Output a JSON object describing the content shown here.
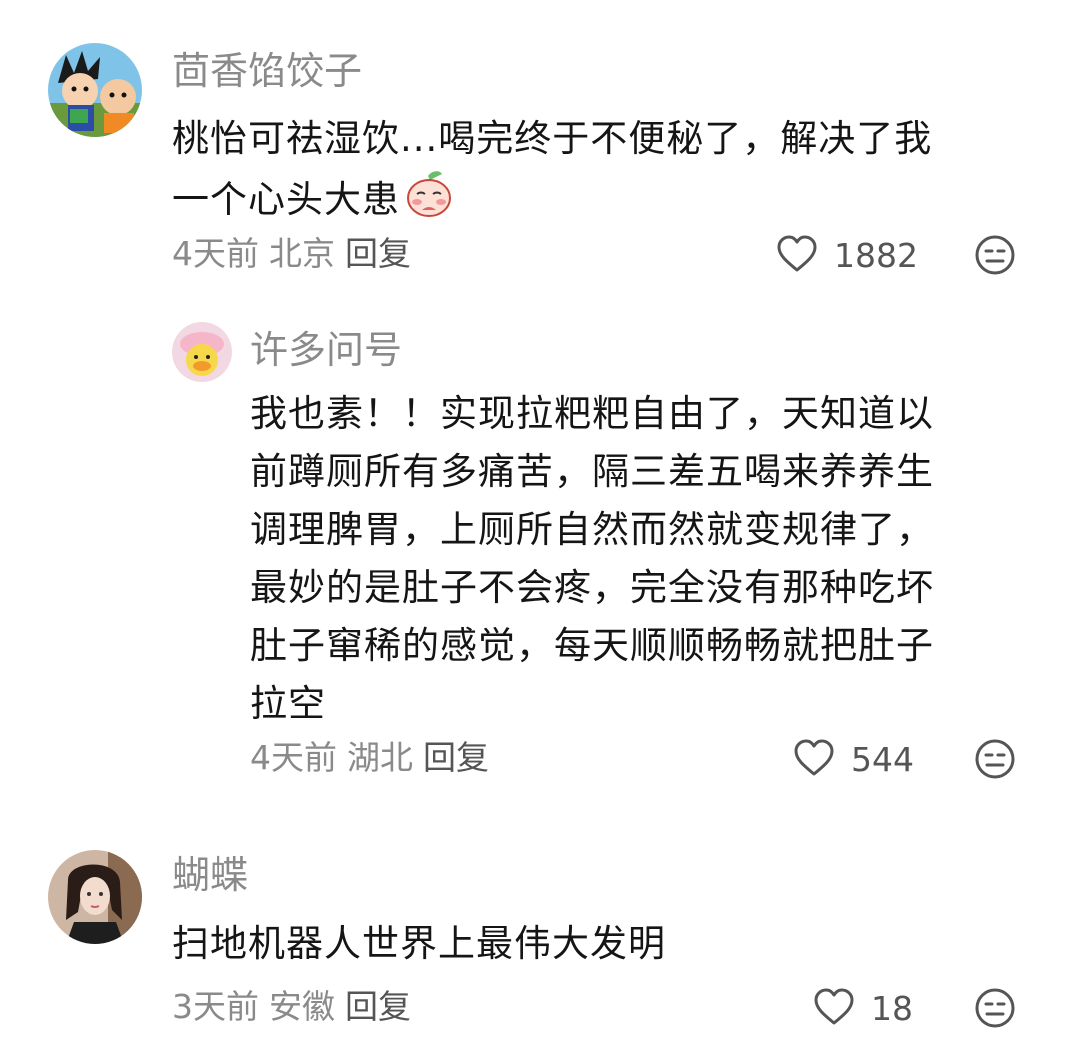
{
  "comments": [
    {
      "username": "茴香馅饺子",
      "lines": [
        "桃怡可祛湿饮...喝完终于不便秘了，解决了我",
        "一个心头大患"
      ],
      "emoji": "peach-face-emoji",
      "time": "4天前",
      "location": "北京",
      "reply_label": "回复",
      "likes": "1882",
      "avatar": "cartoon-two-kids-avatar"
    },
    {
      "username": "许多问号",
      "lines": [
        "我也素！！实现拉粑粑自由了，天知道以",
        "前蹲厕所有多痛苦，隔三差五喝来养养生",
        "调理脾胃，上厕所自然而然就变规律了，",
        "最妙的是肚子不会疼，完全没有那种吃坏",
        "肚子窜稀的感觉，每天顺顺畅畅就把肚子",
        "拉空"
      ],
      "time": "4天前",
      "location": "湖北",
      "reply_label": "回复",
      "likes": "544",
      "avatar": "yellow-duck-avatar"
    },
    {
      "username": "蝴蝶",
      "lines": [
        "扫地机器人世界上最伟大发明"
      ],
      "time": "3天前",
      "location": "安徽",
      "reply_label": "回复",
      "likes": "18",
      "avatar": "woman-photo-avatar"
    }
  ],
  "icons": {
    "like": "heart-outline-icon",
    "dislike": "neutral-face-icon"
  },
  "colors": {
    "secondary_text": "#8a8a8a",
    "icon_gray": "#555555"
  }
}
